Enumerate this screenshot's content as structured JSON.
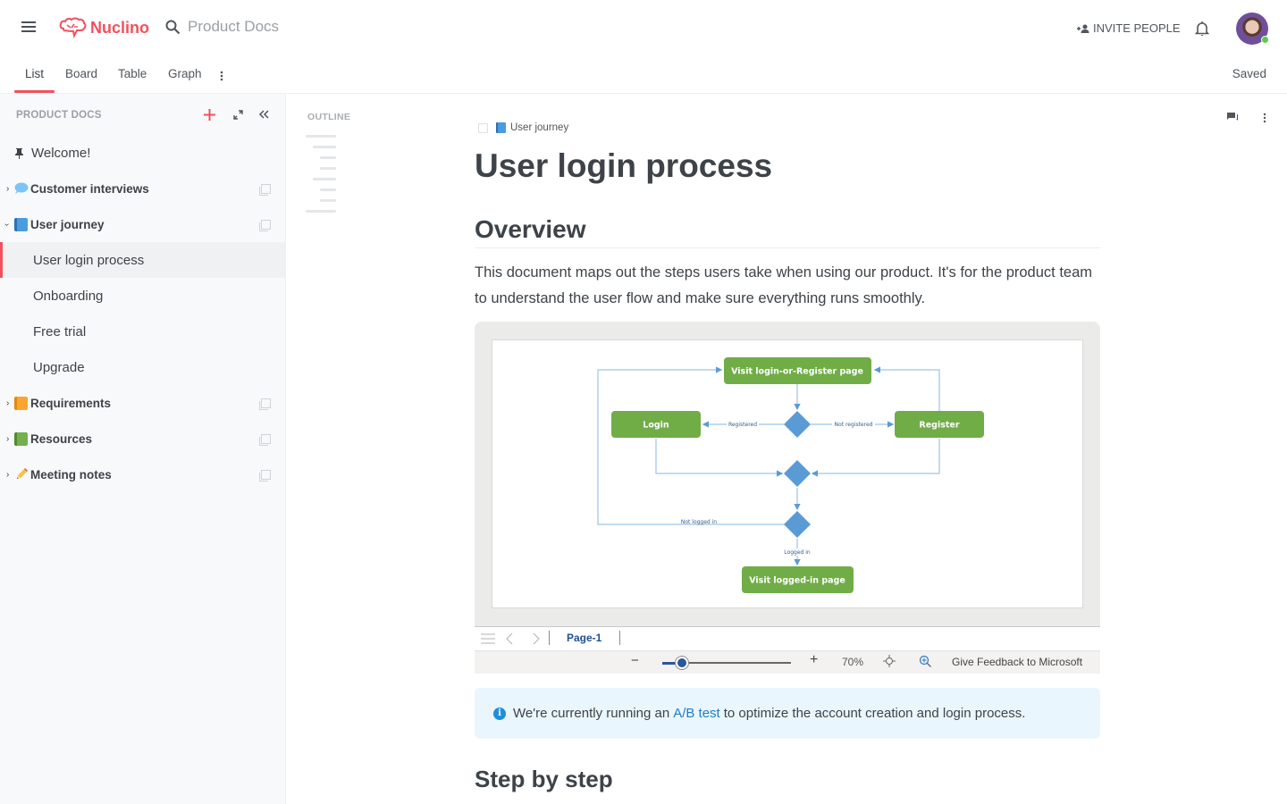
{
  "app": {
    "name": "Nuclino",
    "brand_color": "#f0515e"
  },
  "header": {
    "menu_icon": "hamburger-icon",
    "search_placeholder": "Product Docs",
    "invite_label": "INVITE PEOPLE",
    "notifications_icon": "bell-icon",
    "avatar_status": "online"
  },
  "view_tabs": {
    "items": [
      {
        "label": "List",
        "active": true
      },
      {
        "label": "Board",
        "active": false
      },
      {
        "label": "Table",
        "active": false
      },
      {
        "label": "Graph",
        "active": false
      }
    ],
    "save_status": "Saved"
  },
  "sidebar": {
    "title": "PRODUCT DOCS",
    "items": [
      {
        "label": "Welcome!",
        "icon": "pin-icon",
        "pinned": true
      },
      {
        "label": "Customer interviews",
        "icon": "speech-bubble-icon",
        "collapsed": true
      },
      {
        "label": "User journey",
        "icon": "blue-book-icon",
        "expanded": true
      },
      {
        "label": "User login process",
        "child": true,
        "active": true
      },
      {
        "label": "Onboarding",
        "child": true
      },
      {
        "label": "Free trial",
        "child": true
      },
      {
        "label": "Upgrade",
        "child": true
      },
      {
        "label": "Requirements",
        "icon": "orange-book-icon",
        "collapsed": true
      },
      {
        "label": "Resources",
        "icon": "green-book-icon",
        "collapsed": true
      },
      {
        "label": "Meeting notes",
        "icon": "pencil-icon",
        "collapsed": true
      }
    ]
  },
  "outline": {
    "label": "OUTLINE"
  },
  "document": {
    "breadcrumb": "User journey",
    "title": "User login process",
    "overview_heading": "Overview",
    "overview_text": "This document maps out the steps users take when using our product. It's for the product team to understand the user flow and make sure everything runs smoothly.",
    "callout": {
      "before": "We're currently running an",
      "link": "A/B test",
      "after": "to optimize the account creation and login process."
    },
    "step_heading": "Step by step"
  },
  "diagram": {
    "nodes": {
      "visit_login": "Visit login-or-Register page",
      "login": "Login",
      "register": "Register",
      "visit_logged_in": "Visit logged-in page"
    },
    "edges": {
      "registered": "Registered",
      "not_registered": "Not registered",
      "not_logged_in": "Not logged in",
      "logged_in": "Logged in"
    },
    "viewer": {
      "page_tab": "Page-1",
      "zoom": "70%",
      "zoom_fraction": 0.15,
      "feedback": "Give Feedback to Microsoft"
    }
  }
}
